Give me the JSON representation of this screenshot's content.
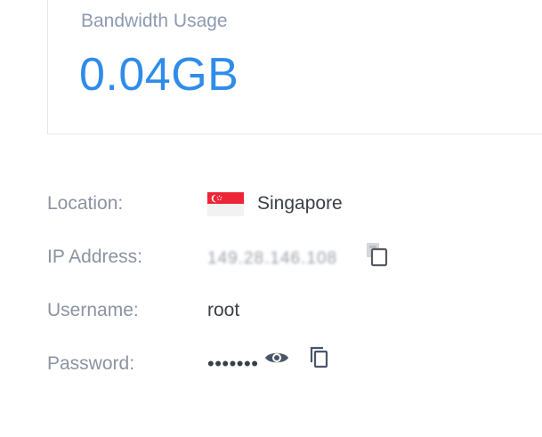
{
  "stats": {
    "title": "Bandwidth Usage",
    "value": "0.04GB",
    "accent_color": "#2f8cea"
  },
  "details": {
    "location": {
      "label": "Location:",
      "value": "Singapore",
      "flag_icon": "singapore-flag-icon"
    },
    "ip_address": {
      "label": "IP Address:",
      "value": "149.28.146.108",
      "copy_icon": "copy-icon"
    },
    "username": {
      "label": "Username:",
      "value": "root"
    },
    "password": {
      "label": "Password:",
      "value": "•••••••",
      "reveal_icon": "eye-icon",
      "copy_icon": "copy-icon"
    }
  }
}
